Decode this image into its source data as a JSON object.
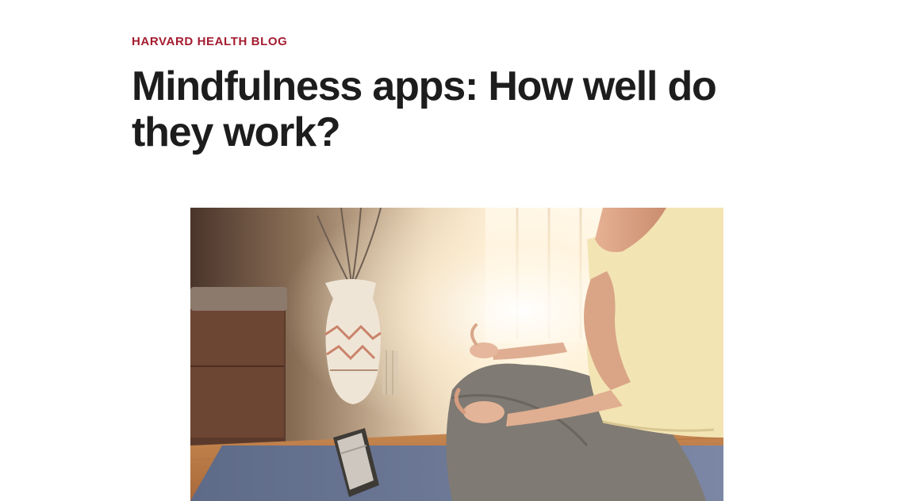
{
  "article": {
    "kicker": "HARVARD HEALTH BLOG",
    "title": "Mindfulness apps: How well do they work?"
  },
  "hero_image": {
    "subject": "person meditating cross-legged on a yoga mat beside a phone in a sunlit room"
  },
  "colors": {
    "kicker": "#a51c30",
    "headline": "#1d1d1d",
    "background": "#ffffff"
  }
}
